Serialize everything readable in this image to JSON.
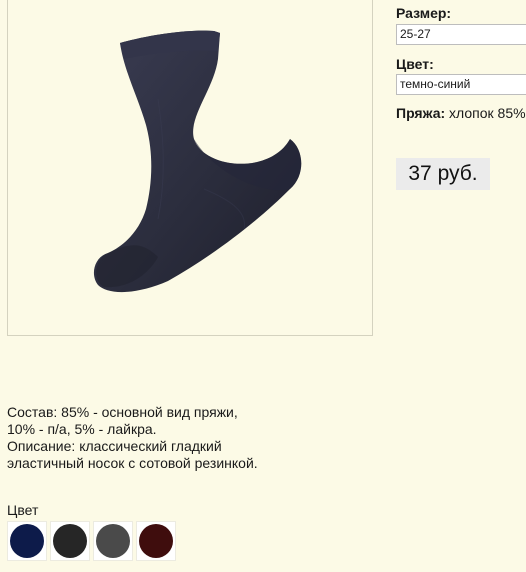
{
  "product": {
    "image_name": "navy-sock-image"
  },
  "options": {
    "size_label": "Размер:",
    "size_value": "25-27",
    "color_label": "Цвет:",
    "color_value": "темно-синий",
    "yarn_label": "Пряжа:",
    "yarn_value": "хлопок 85%"
  },
  "price": {
    "text": "37 руб."
  },
  "description": {
    "composition": "Состав: 85% - основной вид пряжи, 10% - п/а, 5% - лайкра.",
    "details": "Описание: классический гладкий эластичный носок с сотовой резинкой."
  },
  "colors": {
    "heading": "Цвет",
    "swatches": [
      {
        "name": "navy",
        "color": "#0d1b4a"
      },
      {
        "name": "black",
        "color": "#262626"
      },
      {
        "name": "gray",
        "color": "#4a4a4a"
      },
      {
        "name": "burgundy",
        "color": "#3f0d0d"
      }
    ]
  },
  "theme": {
    "page_background": "#fcfae6",
    "sock_color": "#2b2d3d",
    "price_background": "#ebebeb"
  }
}
